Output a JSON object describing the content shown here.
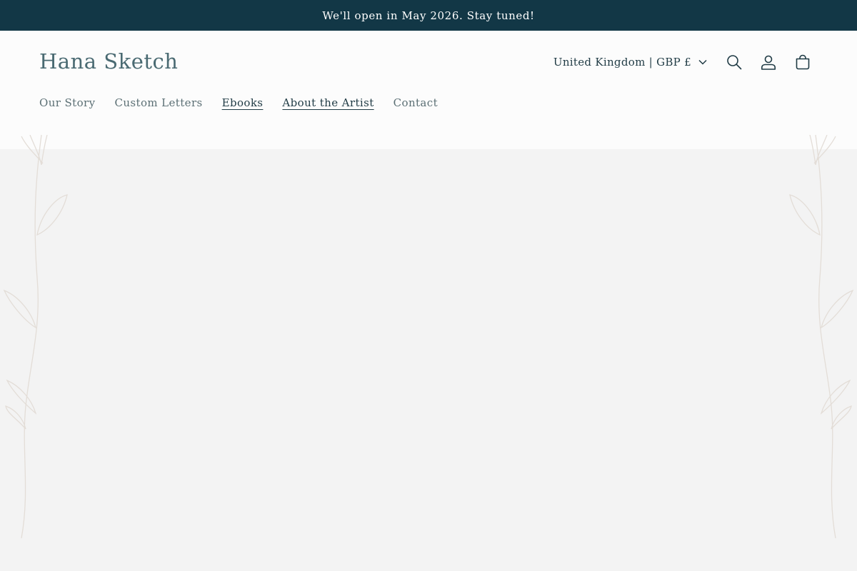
{
  "announcement": {
    "text": "We'll open in May 2026. Stay tuned!"
  },
  "header": {
    "logo": "Hana Sketch",
    "nav": [
      {
        "label": "Our Story"
      },
      {
        "label": "Custom Letters"
      },
      {
        "label": "Ebooks"
      },
      {
        "label": "About the Artist"
      },
      {
        "label": "Contact"
      }
    ],
    "country_selector": {
      "value": "United Kingdom | GBP £",
      "icon": "chevron-down-icon"
    },
    "icons": [
      "search-icon",
      "account-icon",
      "cart-icon"
    ]
  },
  "colors": {
    "announcement_bg": "#123746",
    "header_bg": "#fcfcfc",
    "page_bg": "#f3f3f3",
    "text_dark": "#1f3a44",
    "logo": "#4a6a72",
    "decoration": "#e3ddd7"
  }
}
